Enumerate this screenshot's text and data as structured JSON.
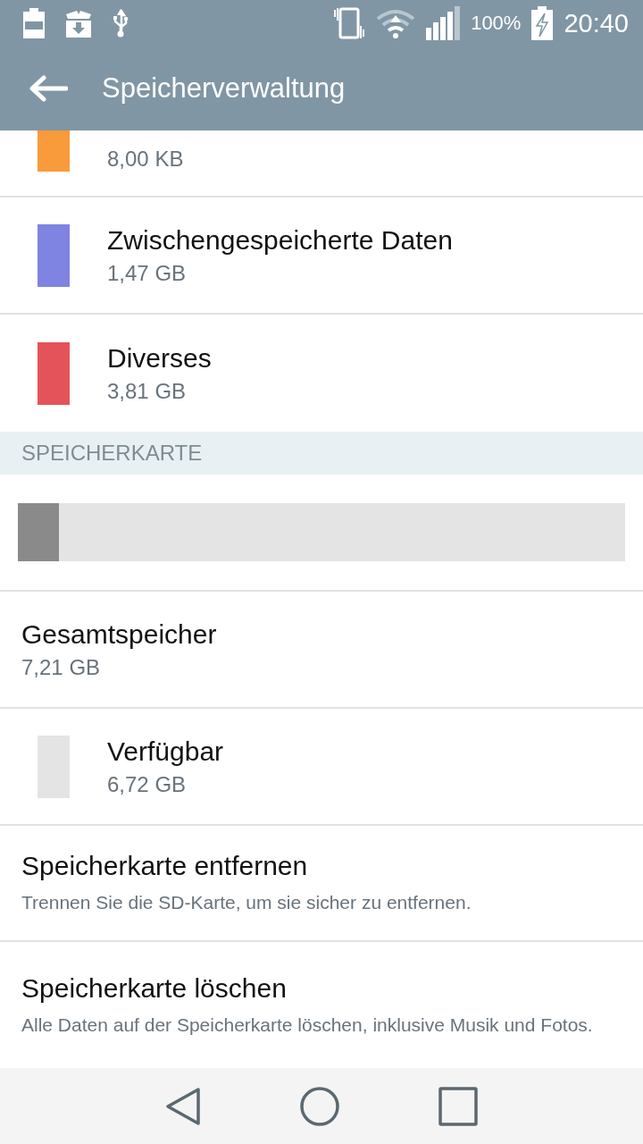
{
  "status_bar": {
    "battery_text": "100%",
    "time": "20:40"
  },
  "app_bar": {
    "title": "Speicherverwaltung"
  },
  "rows": [
    {
      "kind": "legend",
      "color": "#f99a3b",
      "value": "8,00 KB"
    },
    {
      "kind": "legend",
      "color": "#7f83e1",
      "title": "Zwischengespeicherte Daten",
      "value": "1,47 GB"
    },
    {
      "kind": "legend",
      "color": "#e5535a",
      "title": "Diverses",
      "value": "3,81 GB"
    },
    {
      "kind": "header",
      "title": "SPEICHERKARTE"
    },
    {
      "kind": "bar",
      "level": 0.068
    },
    {
      "kind": "info",
      "title": "Gesamtspeicher",
      "value": "7,21 GB"
    },
    {
      "kind": "legend",
      "color": "#e4e4e4",
      "title": "Verfügbar",
      "value": "6,72 GB"
    },
    {
      "kind": "action",
      "title": "Speicherkarte entfernen",
      "description": "Trennen Sie die SD-Karte, um sie sicher zu entfernen."
    },
    {
      "kind": "action",
      "title": "Speicherkarte löschen",
      "description": "Alle Daten auf der Speicherkarte löschen, inklusive Musik und Fotos."
    }
  ]
}
